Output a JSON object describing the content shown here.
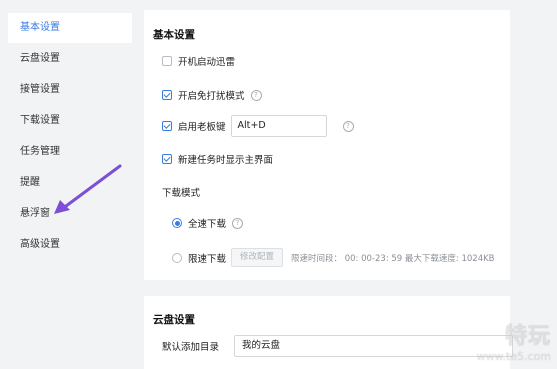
{
  "sidebar": {
    "items": [
      {
        "label": "基本设置"
      },
      {
        "label": "云盘设置"
      },
      {
        "label": "接管设置"
      },
      {
        "label": "下载设置"
      },
      {
        "label": "任务管理"
      },
      {
        "label": "提醒"
      },
      {
        "label": "悬浮窗"
      },
      {
        "label": "高级设置"
      }
    ]
  },
  "basic": {
    "title": "基本设置",
    "autostart_label": "开机启动迅雷",
    "dnd_label": "开启免打扰模式",
    "bosskey_label": "启用老板键",
    "bosskey_value": "Alt+D",
    "show_main_label": "新建任务时显示主界面",
    "download_mode_label": "下载模式",
    "fullspeed_label": "全速下载",
    "limited_label": "限速下载",
    "modify_config": "修改配置",
    "limit_info": "限速时间段： 00: 00-23: 59   最大下载速度: 1024KB"
  },
  "cloud": {
    "title": "云盘设置",
    "default_dir_label": "默认添加目录",
    "default_dir_value": "我的云盘"
  },
  "watermark": {
    "logo": "特玩",
    "url": "www.te5.com"
  },
  "colors": {
    "accent": "#3a7be0",
    "arrow": "#7b4fd6"
  }
}
